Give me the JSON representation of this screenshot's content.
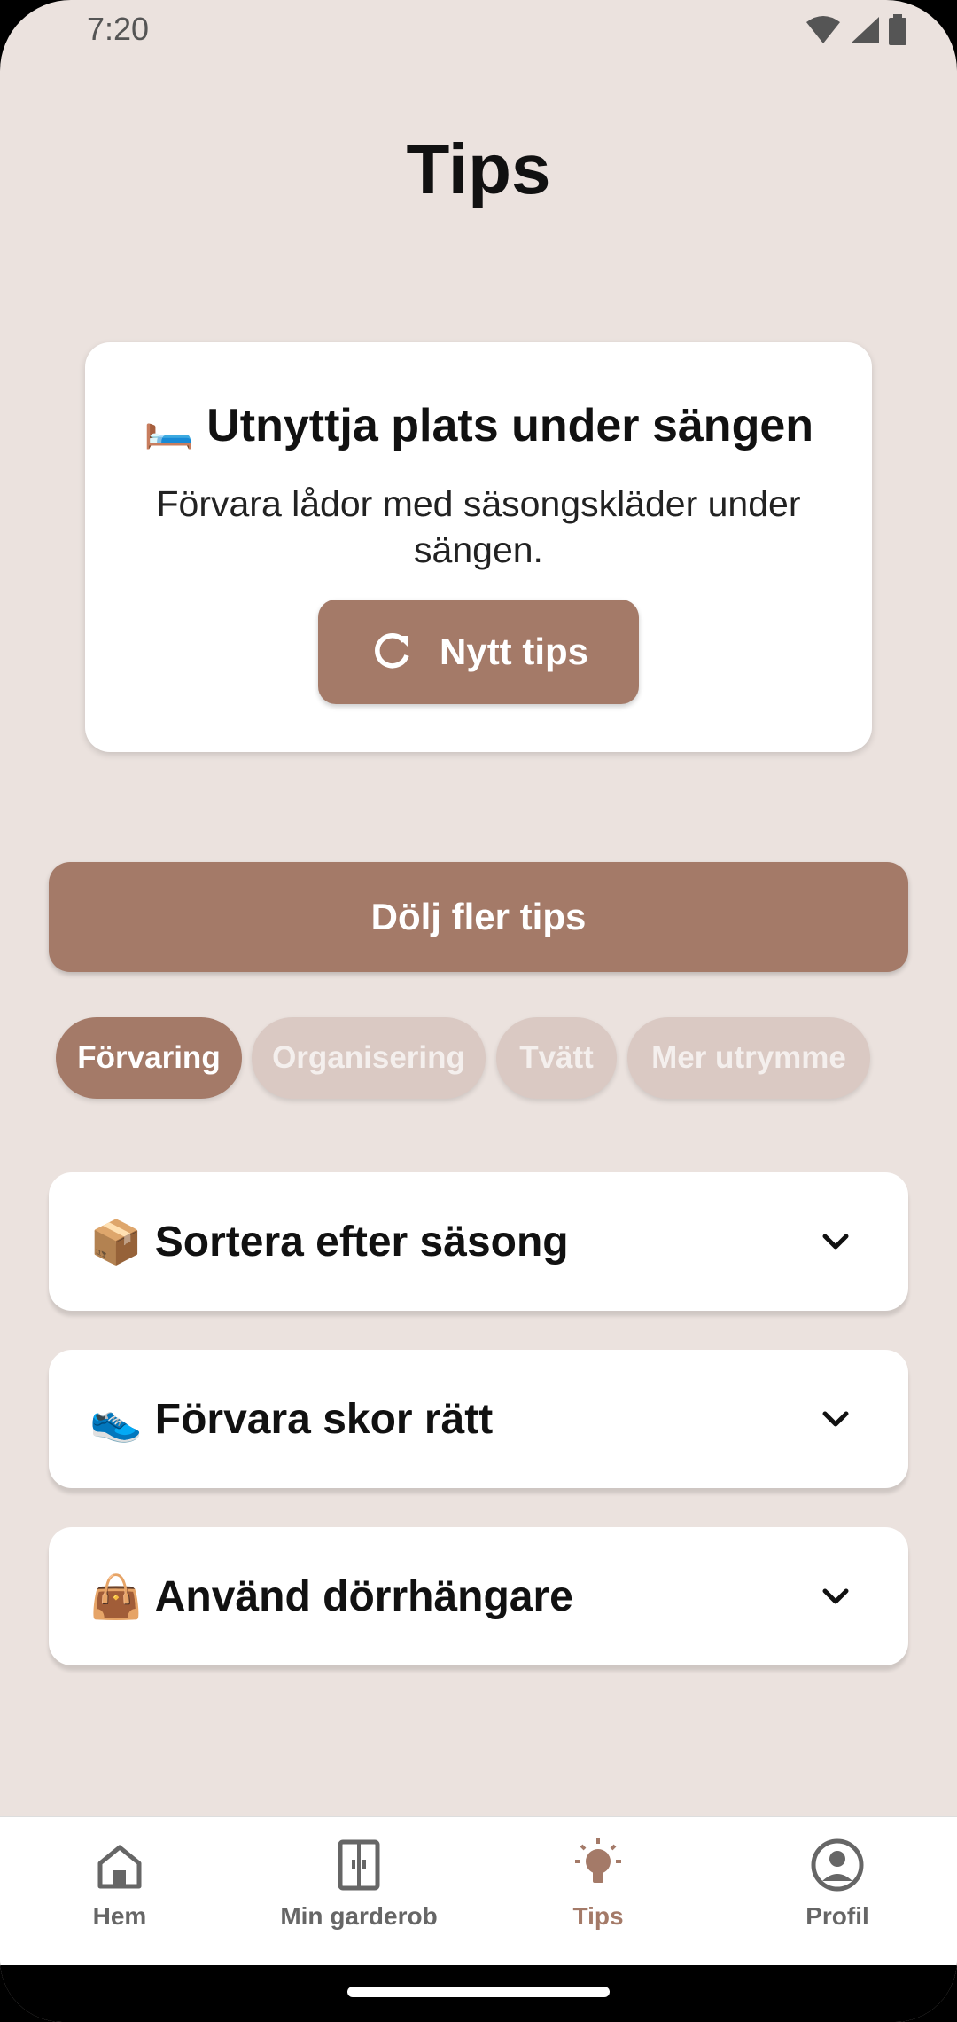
{
  "status_bar": {
    "time": "7:20"
  },
  "page": {
    "title": "Tips"
  },
  "tip_card": {
    "emoji": "🛏️",
    "heading": "Utnyttja plats under sängen",
    "text": "Förvara lådor med säsongskläder under sängen.",
    "new_tip_label": "Nytt tips"
  },
  "hide_button_label": "Dölj fler tips",
  "categories": [
    {
      "label": "Förvaring",
      "selected": true
    },
    {
      "label": "Organisering",
      "selected": false
    },
    {
      "label": "Tvätt",
      "selected": false
    },
    {
      "label": "Mer utrymme",
      "selected": false
    }
  ],
  "accordion": [
    {
      "emoji": "📦",
      "title": "Sortera efter säsong"
    },
    {
      "emoji": "👟",
      "title": "Förvara skor rätt"
    },
    {
      "emoji": "👜",
      "title": "Använd dörrhängare"
    }
  ],
  "bottom_nav": [
    {
      "label": "Hem",
      "icon": "home-icon"
    },
    {
      "label": "Min garderob",
      "icon": "wardrobe-icon"
    },
    {
      "label": "Tips",
      "icon": "lightbulb-icon",
      "active": true
    },
    {
      "label": "Profil",
      "icon": "profile-icon"
    }
  ],
  "colors": {
    "accent": "#a47a68",
    "background": "#ebe2de",
    "chip_inactive": "#dac9c3"
  }
}
